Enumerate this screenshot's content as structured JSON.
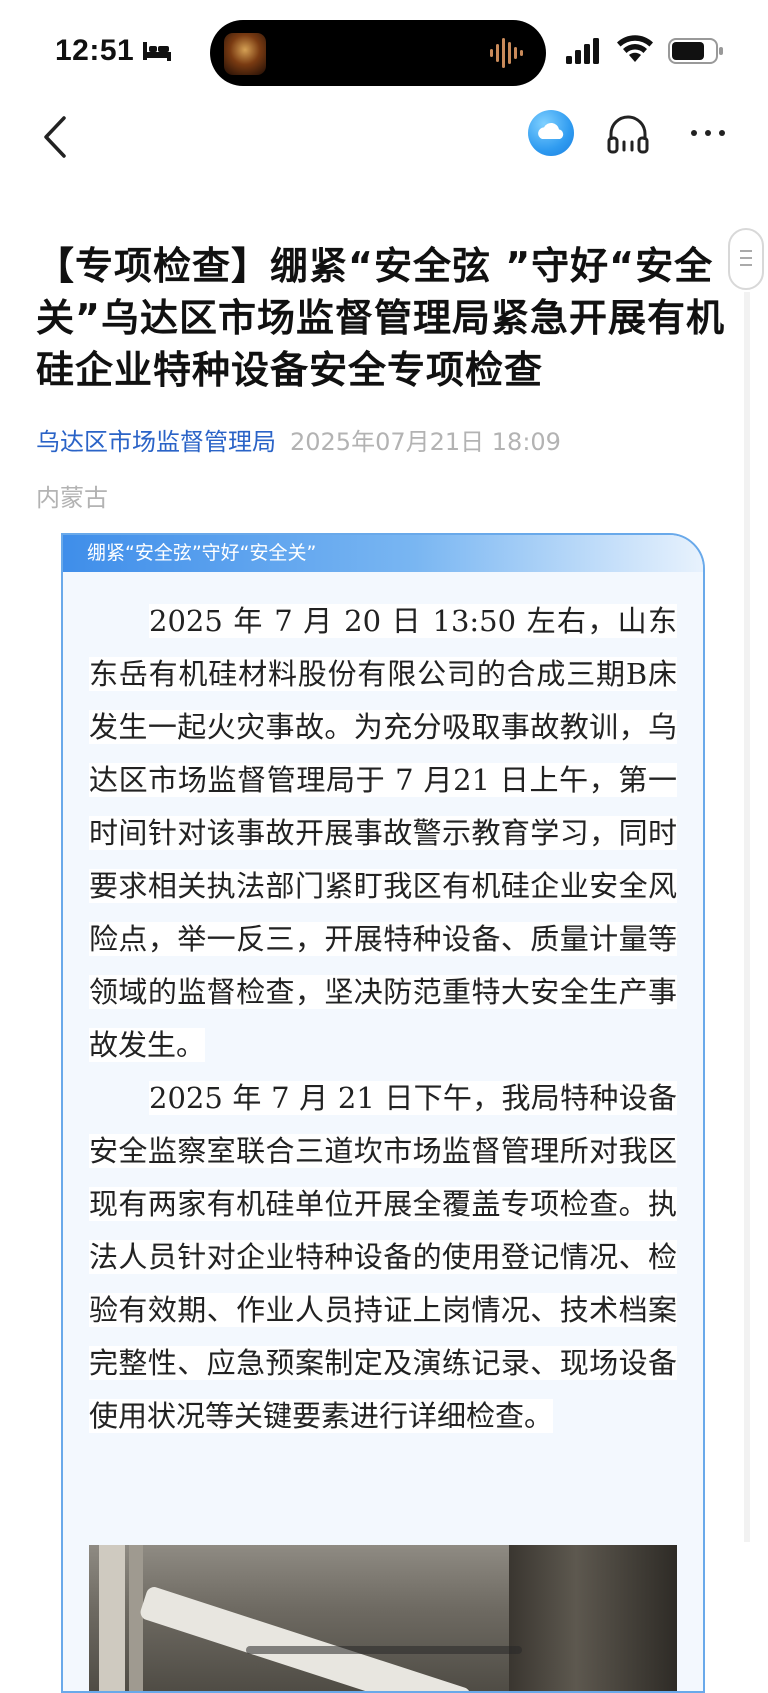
{
  "status_bar": {
    "time": "12:51"
  },
  "nav": {
    "back": "back",
    "icons": [
      "cloud-icon",
      "headphone-icon",
      "more-icon"
    ]
  },
  "article": {
    "title": "【专项检查】绷紧“安全弦 ”守好“安全关”乌达区市场监督管理局紧急开展有机硅企业特种设备安全专项检查",
    "source": "乌达区市场监督管理局",
    "date": "2025年07月21日 18:09",
    "region": "内蒙古"
  },
  "card": {
    "header": "绷紧“安全弦”守好“安全关”",
    "paragraphs": [
      "2025 年 7 月 20 日 13:50 左右，山东东岳有机硅材料股份有限公司的合成三期B床发生一起火灾事故。为充分吸取事故教训，乌达区市场监督管理局于 7 月21 日上午，第一时间针对该事故开展事故警示教育学习，同时要求相关执法部门紧盯我区有机硅企业安全风险点，举一反三，开展特种设备、质量计量等领域的监督检查，坚决防范重特大安全生产事故发生。",
      "2025 年 7 月 21 日下午，我局特种设备安全监察室联合三道坎市场监督管理所对我区现有两家有机硅单位开展全覆盖专项检查。执法人员针对企业特种设备的使用登记情况、检验有效期、作业人员持证上岗情况、技术档案完整性、应急预案制定及演练记录、现场设备使用状况等关键要素进行详细检查。"
    ]
  },
  "colors": {
    "accent_blue": "#2a63c7",
    "card_border": "#69a9ea",
    "card_bg": "#f3f8fe",
    "meta_gray": "#b3b3b3"
  }
}
